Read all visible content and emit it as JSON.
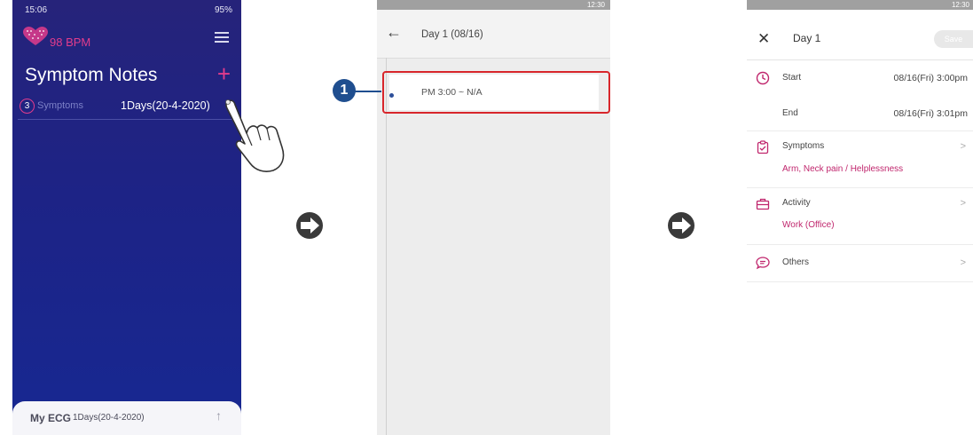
{
  "screen1": {
    "status_time": "15:06",
    "status_icons": "95%",
    "bpm": "98 BPM",
    "title": "Symptom Notes",
    "add": "+",
    "symptom_count": "3",
    "symptoms_label": "Symptoms",
    "days": "1Days(20-4-2020)",
    "chevron": "›",
    "ecg_title": "My ECG",
    "ecg_days": "1Days(20-4-2020)",
    "ecg_arrow": "↑"
  },
  "screen2": {
    "status_time": "12:30",
    "back": "←",
    "title": "Day 1 (08/16)",
    "entry": "PM 3:00 ~ N/A",
    "callout": "1"
  },
  "screen3": {
    "status_time": "12:30",
    "close": "✕",
    "title": "Day 1",
    "save": "Save",
    "start_label": "Start",
    "start_value": "08/16(Fri) 3:00pm",
    "end_label": "End",
    "end_value": "08/16(Fri) 3:01pm",
    "symptoms_label": "Symptoms",
    "symptoms_value": "Arm, Neck pain / Helplessness",
    "activity_label": "Activity",
    "activity_value": "Work (Office)",
    "others_label": "Others",
    "chevron": ">"
  },
  "colors": {
    "accent_pink": "#e23c8c",
    "highlight_red": "#d8262b",
    "callout_blue": "#1f4e8f"
  }
}
